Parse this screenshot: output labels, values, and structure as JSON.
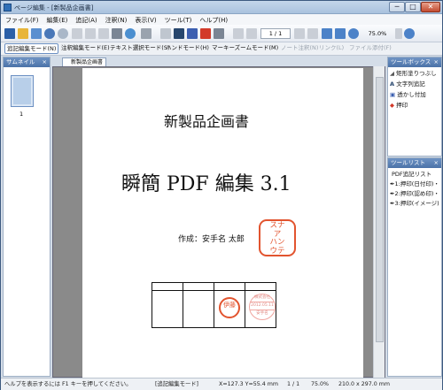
{
  "window": {
    "title": "ページ編集 - [新製品企画書]",
    "min": "─",
    "max": "□",
    "close": "✕"
  },
  "menu": [
    "ファイル(F)",
    "編集(E)",
    "追記(A)",
    "注釈(N)",
    "表示(V)",
    "ツール(T)",
    "ヘルプ(H)"
  ],
  "toolbar": {
    "page_indicator": "1 / 1",
    "zoom": "75.0%"
  },
  "modes": [
    {
      "label": "追記編集モード(N)",
      "state": "active"
    },
    {
      "label": "注釈編集モード(E)",
      "state": "normal"
    },
    {
      "label": "テキスト選択モード(S)",
      "state": "normal"
    },
    {
      "label": "ハンドモード(H)",
      "state": "normal"
    },
    {
      "label": "マーキーズームモード(M)",
      "state": "normal"
    },
    {
      "label": "ノート注釈(N)",
      "state": "disabled"
    },
    {
      "label": "リンク(L)",
      "state": "disabled"
    },
    {
      "label": "ファイル添付(F)",
      "state": "disabled"
    }
  ],
  "thumbnail": {
    "header": "サムネイル",
    "close": "×",
    "page_number": "1"
  },
  "document_tab": "新製品企画書",
  "page": {
    "title": "新製品企画書",
    "product": "瞬簡 PDF 編集 3.1",
    "author": "作成：安手名 太郎",
    "stamp_square": [
      "スナ",
      "ア",
      "ハン",
      "ウテ"
    ],
    "stamp_round": "伊藤",
    "stamp_date_top": "株式会社",
    "stamp_date_mid": "2012.05.11",
    "stamp_date_bot": "安手名"
  },
  "toolbox": {
    "header": "ツールボックス",
    "close": "×",
    "items": [
      "矩形塗りつぶし",
      "文字列追記",
      "透かし付加",
      "押印"
    ]
  },
  "toollist": {
    "header": "ツールリスト",
    "close": "×",
    "title": "PDF追記リスト",
    "items": [
      "1:押印(日付印)・",
      "2:押印(認め印)・",
      "3:押印(イメージ)"
    ]
  },
  "status": {
    "help": "ヘルプを表示するには F1 キーを押してください。",
    "mode": "[追記編集モード]",
    "coords": "X=127.3 Y=55.4 mm",
    "page": "1 / 1",
    "zoom": "75.0%",
    "size": "210.0 x 297.0 mm"
  }
}
